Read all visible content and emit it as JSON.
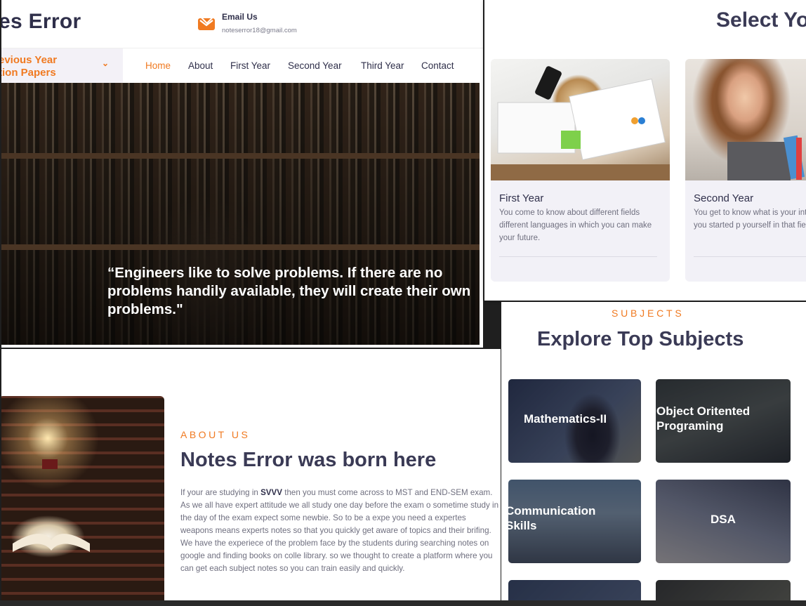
{
  "header": {
    "logo_text": "es Error",
    "email_title": "Email Us",
    "email_address": "noteserror18@gmail.com",
    "dropdown_line1": "evious Year",
    "dropdown_line2": "tion Papers",
    "nav": [
      "Home",
      "About",
      "First Year",
      "Second Year",
      "Third Year",
      "Contact"
    ],
    "active_nav": "Home"
  },
  "hero": {
    "quote": "“Engineers like to solve problems. If there are no problems handily available, they will create their own problems.\""
  },
  "select_year": {
    "title": "Select Yo",
    "cards": [
      {
        "name": "First Year",
        "description": "You come to know about different fields different languages in which you can make your future."
      },
      {
        "name": "Second Year",
        "description": "You get to know what is your interest and you started p yourself in that field."
      }
    ]
  },
  "about": {
    "kicker": "ABOUT US",
    "title": "Notes Error was born here",
    "body_before": "If your are studying in ",
    "body_bold": "SVVV",
    "body_after": " then you must come across to MST and END-SEM exam. As we all have expert attitude we all study one day before the exam o sometime study in the day of the exam expect some newbie. So to be a expe you need a expertes weapons means experts notes so that you quickly get aware of topics and their brifing. We have the experiece of the problem face by the students during searching notes on google and finding books on colle library. so we thought to create a platform where you can get each subject notes so you can train easily and quickly."
  },
  "subjects": {
    "kicker": "SUBJECTS",
    "title": "Explore Top Subjects",
    "items": [
      "Mathematics-II",
      "Object Oritented Programing",
      "Communication Skills",
      "DSA"
    ]
  },
  "colors": {
    "accent": "#f07a21",
    "heading": "#3a3a55",
    "body_text": "#6f6f7f",
    "card_bg": "#f2f1f7"
  }
}
